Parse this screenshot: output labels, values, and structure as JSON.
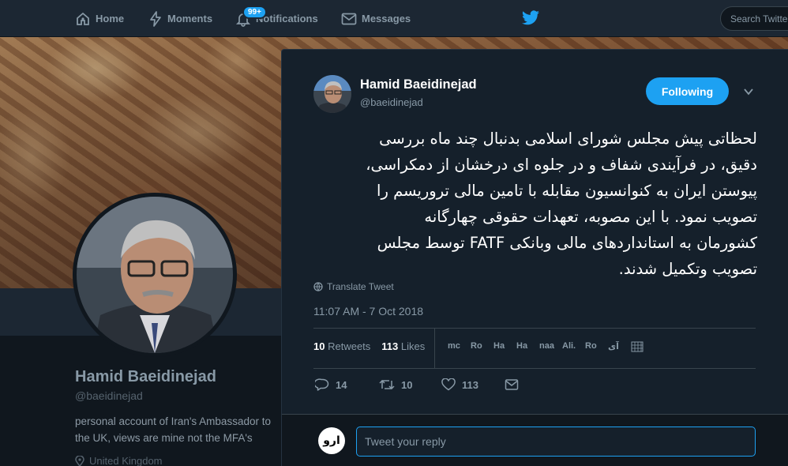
{
  "nav": {
    "home": "Home",
    "moments": "Moments",
    "notifications": "Notifications",
    "notifications_badge": "99+",
    "messages": "Messages",
    "search_placeholder": "Search Twitter"
  },
  "profile": {
    "name": "Hamid Baeidinejad",
    "handle": "@baeidinejad",
    "bio": "personal account of Iran's Ambassador to the UK, views are mine not the MFA's",
    "location": "United Kingdom"
  },
  "tweet": {
    "author_name": "Hamid Baeidinejad",
    "author_handle": "@baeidinejad",
    "follow_label": "Following",
    "text_lines": [
      "لحظاتی پیش مجلس شورای اسلامی بدنبال چند ماه بررسی",
      "دقیق، در فرآیندی شفاف و در جلوه ای درخشان از دمکراسی،",
      "پیوستن ایران به کنوانسیون مقابله با تامین مالی تروریسم را",
      "تصویب نمود. با این مصوبه، تعهدات حقوقی چهارگانه",
      "کشورمان به استانداردهای مالی وبانکی FATF توسط مجلس",
      "تصویب وتکمیل شدند."
    ],
    "translate_label": "Translate Tweet",
    "timestamp": "11:07 AM - 7 Oct 2018",
    "retweets_count": "10",
    "retweets_label": "Retweets",
    "likes_count": "113",
    "likes_label": "Likes",
    "likers": [
      "mc",
      "Ro",
      "Ha",
      "Ha",
      "naa",
      "Ali.",
      "Ro",
      "آی"
    ],
    "actions": {
      "reply_count": "14",
      "retweet_count": "10",
      "like_count": "113"
    }
  },
  "reply": {
    "placeholder": "Tweet your reply",
    "avatar_text": "ارو"
  },
  "colors": {
    "accent": "#1da1f2",
    "background": "#10171e",
    "panel": "#15202b",
    "muted": "#8899a6"
  }
}
